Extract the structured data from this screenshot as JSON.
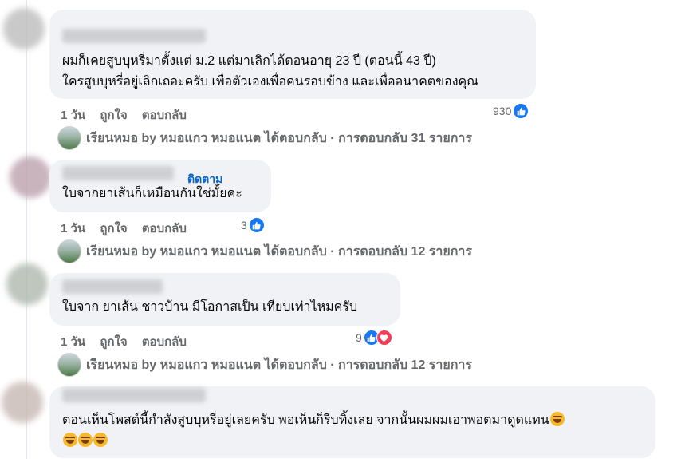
{
  "comments": [
    {
      "lines": [
        "ผมก็เคยสูบบุหรี่มาตั้งแต่ ม.2 แต่มาเลิกได้ตอนอายุ 23 ปี (ตอนนี้ 43 ปี)",
        "ใครสูบบุหรี่อยู่เลิกเถอะครับ เพื่อตัวเองเพื่อคนรอบข้าง และเพื่ออนาคตของคุณ"
      ],
      "time": "1 วัน",
      "like_label": "ถูกใจ",
      "reply_label": "ตอบกลับ",
      "reaction_count": "930",
      "reply_summary": "เรียนหมอ by หมอแกว หมอแนต ได้ตอบกลับ · การตอบกลับ 31 รายการ"
    },
    {
      "follow_label": "ติดตาม",
      "lines": [
        "ใบจากยาเส้นก็เหมือนกันใช่มั้ยคะ"
      ],
      "time": "1 วัน",
      "like_label": "ถูกใจ",
      "reply_label": "ตอบกลับ",
      "reaction_count": "3",
      "reply_summary": "เรียนหมอ by หมอแกว หมอแนต ได้ตอบกลับ · การตอบกลับ 12 รายการ"
    },
    {
      "lines": [
        "ใบจาก ยาเส้น ชาวบ้าน มีโอกาสเป็น เทียบเท่าไหมครับ"
      ],
      "time": "1 วัน",
      "like_label": "ถูกใจ",
      "reply_label": "ตอบกลับ",
      "reaction_count": "9",
      "reply_summary": "เรียนหมอ by หมอแกว หมอแนต ได้ตอบกลับ · การตอบกลับ 12 รายการ"
    },
    {
      "lines": [
        "ตอนเห็นโพสต์นี้กำลังสูบบุหรี่อยู่เลยครับ พอเห็นก็รีบทิ้งเลย จากนั้นผมผมเอาพอตมาดูดแทน",
        ""
      ]
    }
  ],
  "icons": {
    "like": "like-thumb-icon",
    "love": "heart-icon",
    "laugh": "rolling-laughing-emoji"
  },
  "colors": {
    "bubble": "#f0f2f5",
    "meta_text": "#65676b",
    "link_blue": "#0064d1",
    "like_blue": "#1877f2",
    "love_red": "#f33e58"
  }
}
